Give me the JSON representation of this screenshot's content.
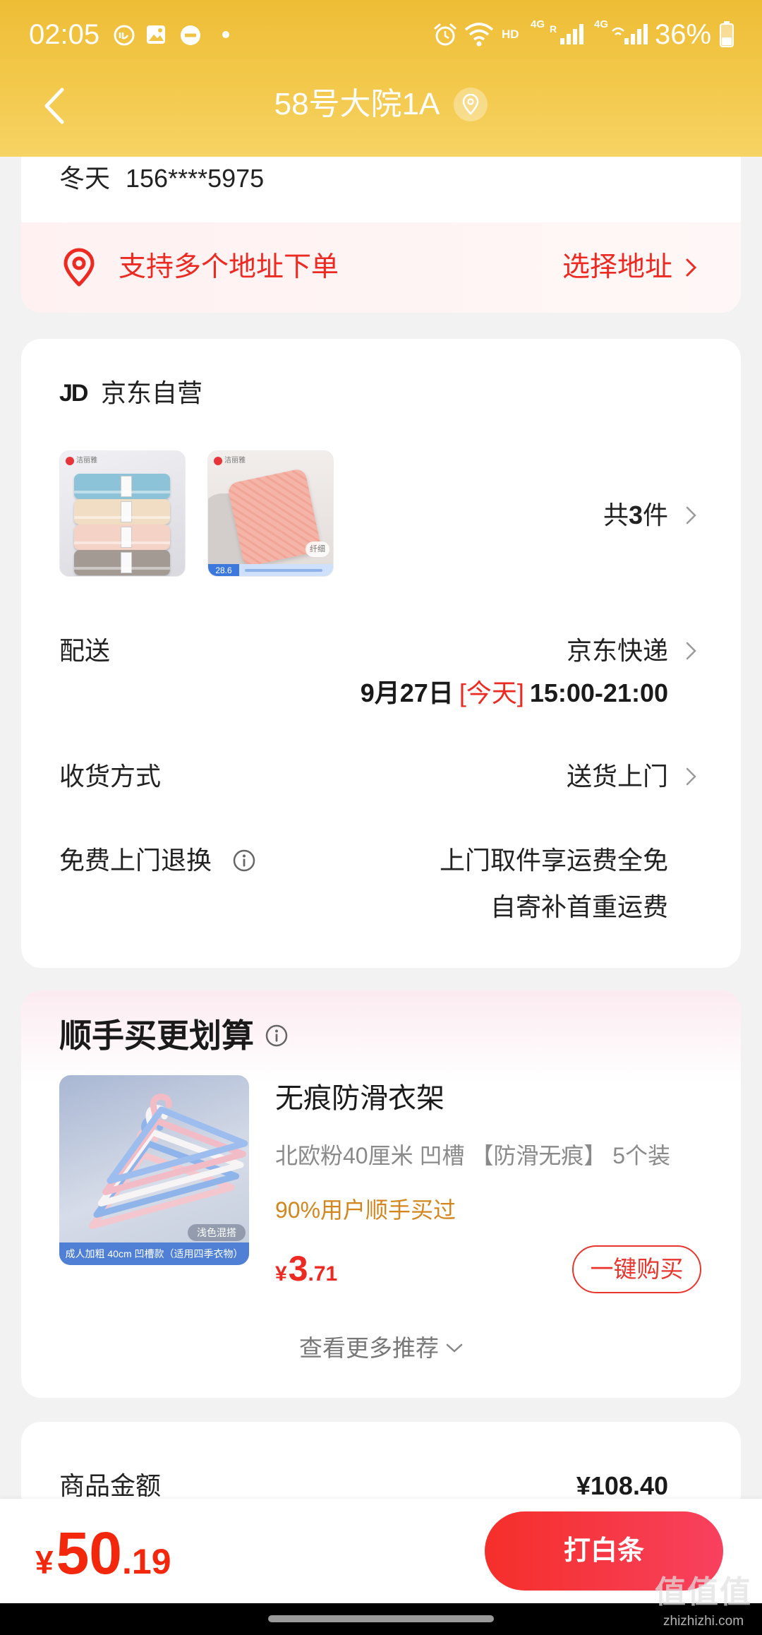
{
  "status_bar": {
    "time": "02:05",
    "hd": "HD",
    "net1": "4G",
    "roaming": "R",
    "net2": "4G",
    "battery": "36%",
    "icons": [
      "app-notification-icon",
      "gallery-icon",
      "do-not-disturb-icon",
      "alarm-icon",
      "wifi-icon",
      "signal-icon",
      "battery-icon"
    ]
  },
  "header": {
    "title": "58号大院1A",
    "back_icon": "chevron-left-icon",
    "location_icon": "location-pin-icon"
  },
  "address": {
    "name": "冬天",
    "phone": "156****5975",
    "multi_order_label": "支持多个地址下单",
    "select_label": "选择地址"
  },
  "shop": {
    "logo": "JD",
    "name": "京东自营",
    "products": [
      {
        "brand_logo": "洁丽雅"
      },
      {
        "brand_logo": "洁丽雅",
        "badge": "纤细",
        "price_tag": "28.6"
      }
    ],
    "count_prefix": "共",
    "count": "3",
    "count_suffix": "件"
  },
  "delivery": {
    "label": "配送",
    "carrier": "京东快递",
    "date": "9月27日",
    "today_tag": "[今天]",
    "time_window": "15:00-21:00"
  },
  "receive": {
    "label": "收货方式",
    "method": "送货上门"
  },
  "returns": {
    "label": "免费上门退换",
    "line1": "上门取件享运费全免",
    "line2": "自寄补首重运费"
  },
  "recommend": {
    "title": "顺手买更划算",
    "item": {
      "name": "无痕防滑衣架",
      "spec": "北欧粉40厘米 凹槽 【防滑无痕】 5个装",
      "social_proof": "90%用户顺手买过",
      "currency": "¥",
      "price_int": "3",
      "price_dec": ".71",
      "buy_label": "一键购买",
      "image_badge": "浅色混搭",
      "image_caption": "成人加粗 40cm 凹槽款（适用四季衣物）"
    },
    "more_label": "查看更多推荐"
  },
  "summary": {
    "goods_amount_label": "商品金额",
    "goods_amount": "¥108.40"
  },
  "checkout": {
    "currency": "¥",
    "total_int": "50",
    "total_dec": ".19",
    "pay_label": "打白条"
  },
  "watermark": {
    "mark": "值值值",
    "site": "zhizhizhi.com"
  },
  "colors": {
    "header_yellow": "#f3c94c",
    "brand_red": "#f2270c",
    "accent_orange": "#d4861e",
    "page_bg": "#f2f2f2"
  }
}
